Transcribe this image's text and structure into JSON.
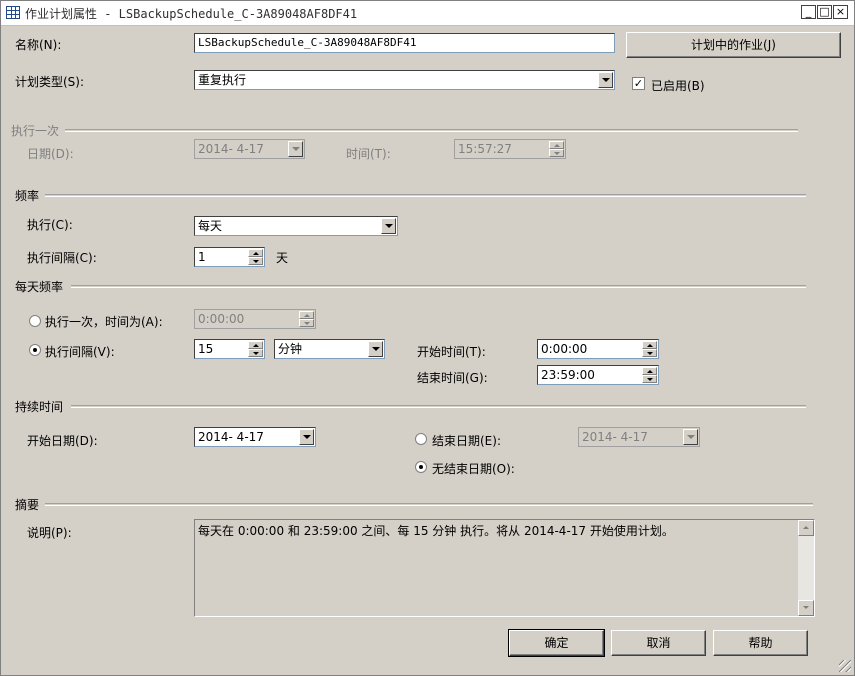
{
  "window": {
    "title": "作业计划属性 - LSBackupSchedule_C-3A89048AF8DF41",
    "minimize": "_",
    "maximize": "□",
    "close": "×"
  },
  "name": {
    "label": "名称(N):",
    "value": "LSBackupSchedule_C-3A89048AF8DF41"
  },
  "jobs_button": "计划中的作业(J)",
  "schedule_type": {
    "label": "计划类型(S):",
    "value": "重复执行"
  },
  "enabled": {
    "label": "已启用(B)",
    "checked": true,
    "mark": "✓"
  },
  "one_time": {
    "section": "执行一次",
    "date_label": "日期(D):",
    "date_value": "2014- 4-17",
    "time_label": "时间(T):",
    "time_value": "15:57:27"
  },
  "frequency": {
    "section": "频率",
    "occurs_label": "执行(C):",
    "occurs_value": "每天",
    "recurs_label": "执行间隔(C):",
    "recurs_value": "1",
    "recurs_unit": "天"
  },
  "daily": {
    "section": "每天频率",
    "once_label": "执行一次，时间为(A):",
    "once_value": "0:00:00",
    "once_selected": false,
    "every_label": "执行间隔(V):",
    "every_value": "15",
    "every_unit": "分钟",
    "every_selected": true,
    "start_label": "开始时间(T):",
    "start_value": "0:00:00",
    "end_label": "结束时间(G):",
    "end_value": "23:59:00"
  },
  "duration": {
    "section": "持续时间",
    "start_label": "开始日期(D):",
    "start_value": "2014- 4-17",
    "end_label": "结束日期(E):",
    "end_value": "2014- 4-17",
    "end_selected": false,
    "noend_label": "无结束日期(O):",
    "noend_selected": true
  },
  "summary": {
    "section": "摘要",
    "desc_label": "说明(P):",
    "desc_value": "每天在 0:00:00 和 23:59:00 之间、每 15 分钟 执行。将从 2014-4-17 开始使用计划。"
  },
  "buttons": {
    "ok": "确定",
    "cancel": "取消",
    "help": "帮助"
  }
}
